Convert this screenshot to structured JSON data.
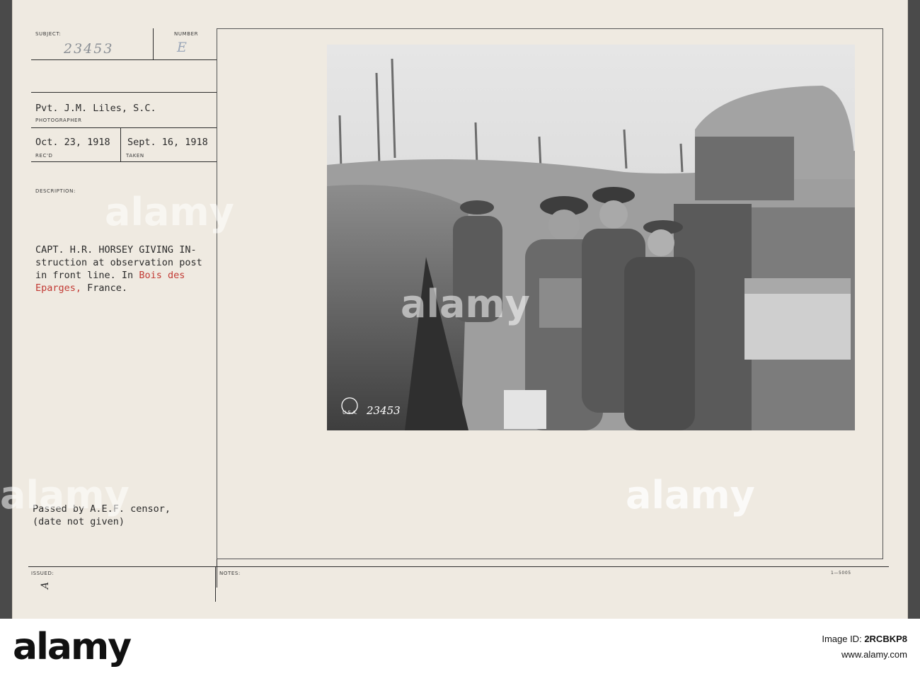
{
  "card": {
    "subject_label": "SUBJECT:",
    "number_label": "NUMBER",
    "subject_number": "23453",
    "number_value": "E",
    "photographer": "Pvt. J.M. Liles, S.C.",
    "photographer_label": "PHOTOGRAPHER",
    "received_date": "Oct. 23, 1918",
    "received_label": "REC'D",
    "taken_date": "Sept. 16, 1918",
    "taken_label": "TAKEN",
    "description_label": "DESCRIPTION:",
    "description_lines": [
      "CAPT. H.R. HORSEY GIVING IN-",
      "struction at observation post",
      "in front line. In "
    ],
    "place_red_1": "Bois des",
    "place_red_2": "Eparges,",
    "place_tail": " France.",
    "censor_line_1": "Passed by A.E.F. censor,",
    "censor_line_2": "(date not given)",
    "issued_label": "ISSUED:",
    "issued_mark": "A",
    "notes_label": "NOTES:",
    "form_number": "1—5005",
    "photo_stamp_number": "23453",
    "photo_stamp_text": "U.S.A."
  },
  "watermark": {
    "text": "alamy"
  },
  "footer": {
    "logo": "alamy",
    "image_id_label": "Image ID:",
    "image_id": "2RCBKP8",
    "site": "www.alamy.com"
  },
  "colors": {
    "card_bg": "#efeae1",
    "red_ink": "#c23a34",
    "footer_bg": "#ffffff"
  }
}
